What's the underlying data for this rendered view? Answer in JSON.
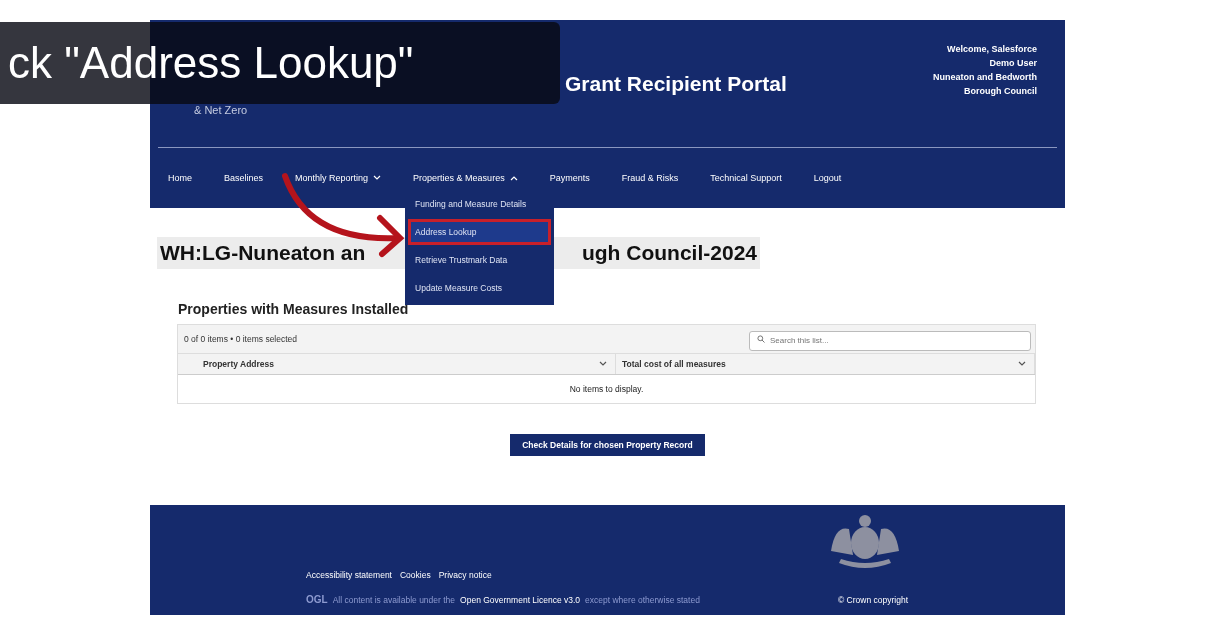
{
  "caption": "ck \"Address Lookup\"",
  "header": {
    "logo_lines": [
      "& Net Zero"
    ],
    "title": "Grant Recipient Portal",
    "welcome_lines": [
      "Welcome, Salesforce",
      "Demo User",
      "Nuneaton and Bedworth",
      "Borough Council"
    ]
  },
  "nav": [
    {
      "label": "Home",
      "kind": "link"
    },
    {
      "label": "Baselines",
      "kind": "link"
    },
    {
      "label": "Monthly Reporting",
      "kind": "menu",
      "expanded": false
    },
    {
      "label": "Properties & Measures",
      "kind": "menu",
      "expanded": true,
      "items": [
        {
          "label": "Funding and Measure Details",
          "highlighted": false
        },
        {
          "label": "Address Lookup",
          "highlighted": true
        },
        {
          "label": "Retrieve Trustmark Data",
          "highlighted": false
        },
        {
          "label": "Update Measure Costs",
          "highlighted": false
        }
      ]
    },
    {
      "label": "Payments",
      "kind": "link"
    },
    {
      "label": "Fraud & Risks",
      "kind": "link"
    },
    {
      "label": "Technical Support",
      "kind": "link"
    },
    {
      "label": "Logout",
      "kind": "link"
    }
  ],
  "annotation_arrow": true,
  "page_title_parts": [
    "WH:LG-Nuneaton an",
    "ugh Council-2024"
  ],
  "list": {
    "title": "Properties with Measures Installed",
    "count": "0 of 0 items • 0 items selected",
    "search": {
      "placeholder": "Search this list..."
    },
    "columns": [
      "Property Address",
      "Total cost of all measures"
    ],
    "empty": "No items to display."
  },
  "button": "Check Details for chosen Property Record",
  "footer": {
    "links": [
      "Accessibility statement",
      "Cookies",
      "Privacy notice"
    ],
    "ogl": "OGL",
    "licence_before": "All content is available under the",
    "licence_link": "Open Government Licence v3.0",
    "licence_after": "except where otherwise stated",
    "copyright": "© Crown copyright"
  }
}
